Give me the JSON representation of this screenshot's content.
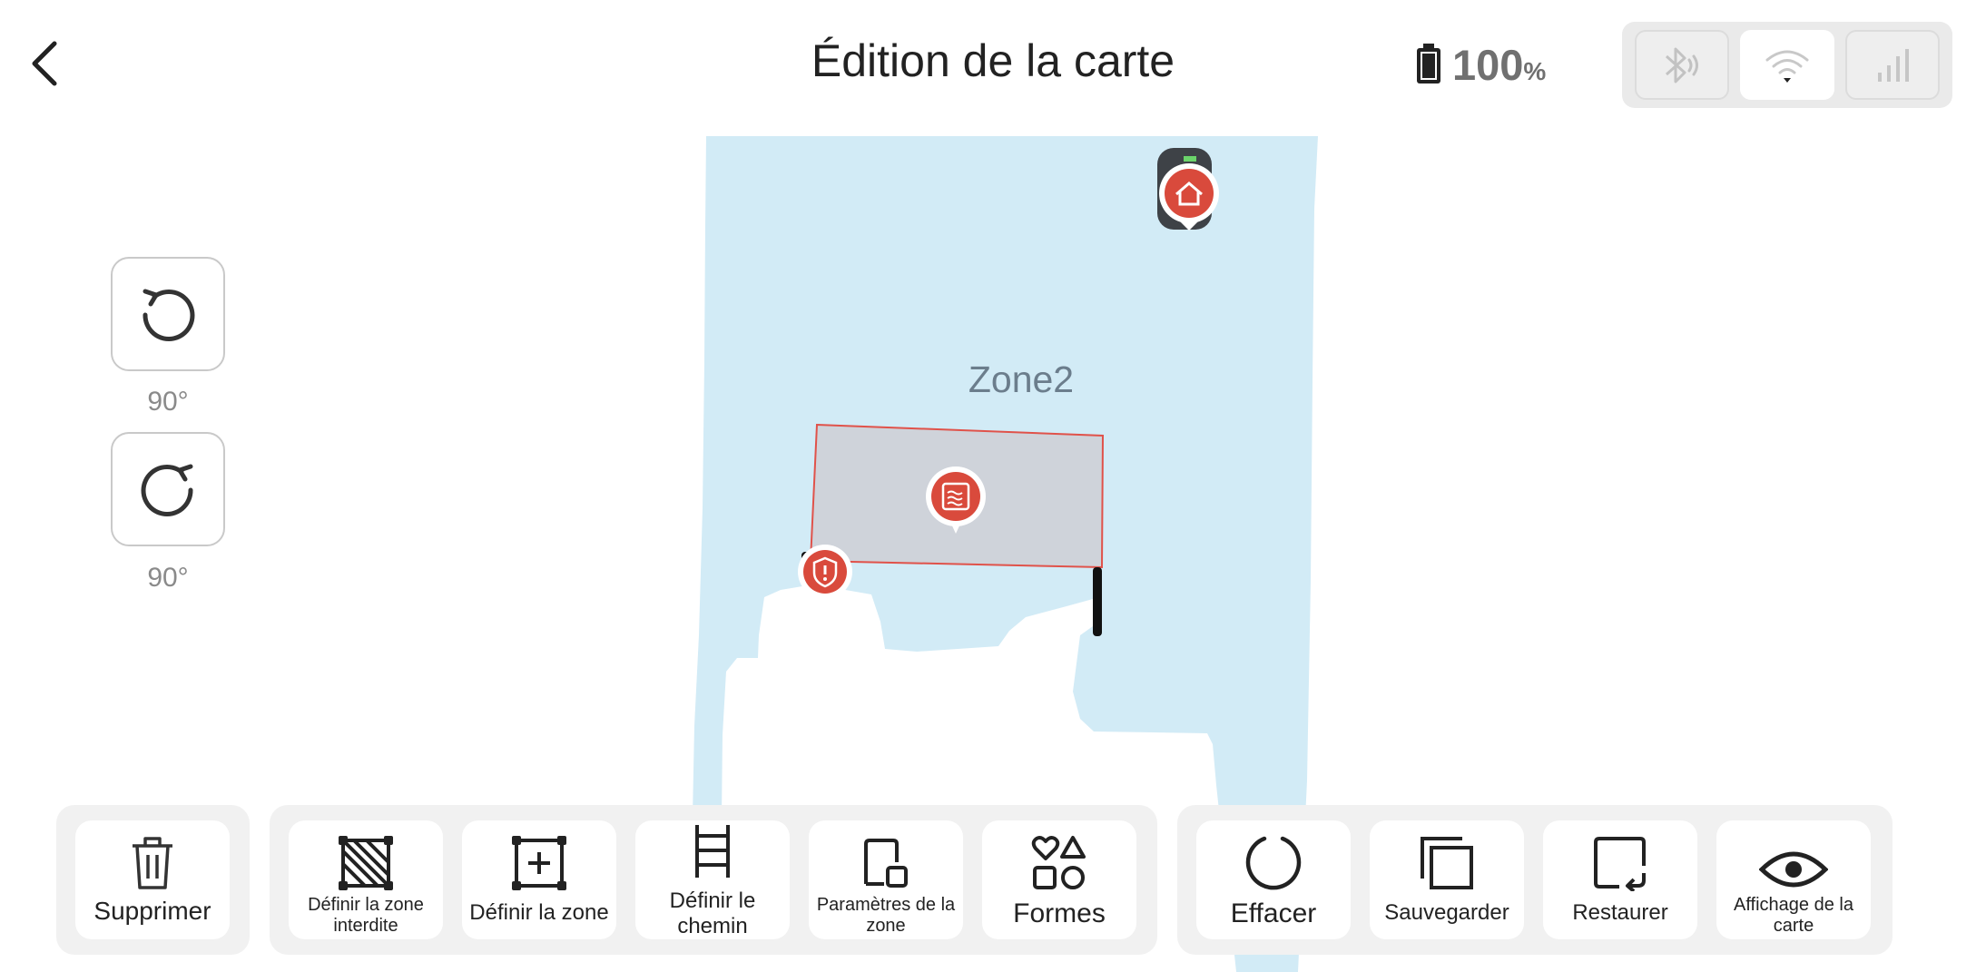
{
  "header": {
    "title": "Édition de la carte",
    "back_icon": "chevron-left-icon",
    "battery": {
      "value": "100",
      "unit": "%",
      "level": 1.0,
      "icon": "battery-icon"
    },
    "connectivity": [
      {
        "name": "bluetooth",
        "icon": "bluetooth-icon",
        "active": false
      },
      {
        "name": "wifi",
        "icon": "wifi-icon",
        "active": true
      },
      {
        "name": "cellular",
        "icon": "cellular-signal-icon",
        "active": false
      }
    ]
  },
  "rotation": {
    "counterclockwise_label": "90°",
    "clockwise_label": "90°"
  },
  "map": {
    "zone_label": "Zone2",
    "colors": {
      "lawn": "#d2ebf6",
      "forbidden_zone_fill": "#cfd3da",
      "forbidden_zone_border": "#e0524a",
      "marker": "#d94a3c"
    },
    "markers": [
      "home-icon",
      "forbidden-zone-icon",
      "shield-warning-icon"
    ]
  },
  "toolbar": {
    "delete_label": "Supprimer",
    "forbidden_zone_label": "Définir la zone interdite",
    "define_zone_label": "Définir la zone",
    "define_path_label": "Définir le chemin",
    "zone_settings_label": "Paramètres de la zone",
    "shapes_label": "Formes",
    "clear_label": "Effacer",
    "save_label": "Sauvegarder",
    "restore_label": "Restaurer",
    "map_display_label": "Affichage de la carte"
  }
}
